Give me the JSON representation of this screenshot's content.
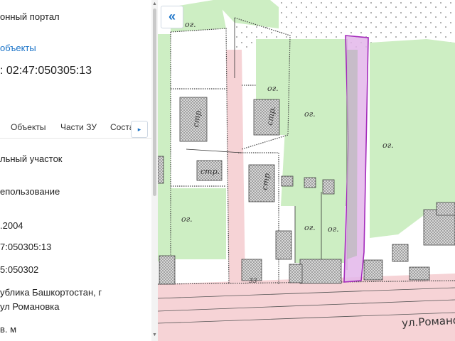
{
  "panel": {
    "portal_title": "онный портал",
    "objects_link": "объекты",
    "cadastral_heading": ": 02:47:050305:13",
    "tabs": [
      "Объекты",
      "Части ЗУ",
      "Соста"
    ],
    "fields": [
      "льный участок",
      "епользование",
      ".2004",
      "7:050305:13",
      "5:050302",
      "ублика Башкортостан, г",
      "ул Романовка",
      "в. м"
    ]
  },
  "map": {
    "labels": {
      "og": "ог.",
      "str": "стр.",
      "num": "33",
      "street": "ул.Романовка"
    },
    "colors": {
      "greenery": "#cdeec3",
      "road": "#f6d3d6",
      "highlight_fill": "#e3b6ea",
      "highlight_stroke": "#a42bbb",
      "building": "#b9b9b9"
    }
  },
  "controls": {
    "collapse_icon": "«",
    "tab_next_icon": "▸"
  }
}
